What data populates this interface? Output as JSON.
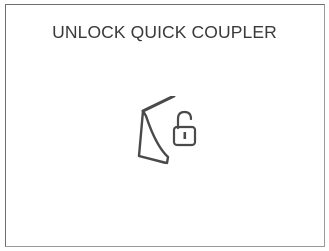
{
  "dialog": {
    "title": "UNLOCK QUICK COUPLER",
    "icon": "bucket-unlock-icon"
  },
  "colors": {
    "background": "#ffffff",
    "border": "#6f6f6f",
    "text": "#3a3a3a",
    "icon": "#4a4a4a"
  }
}
